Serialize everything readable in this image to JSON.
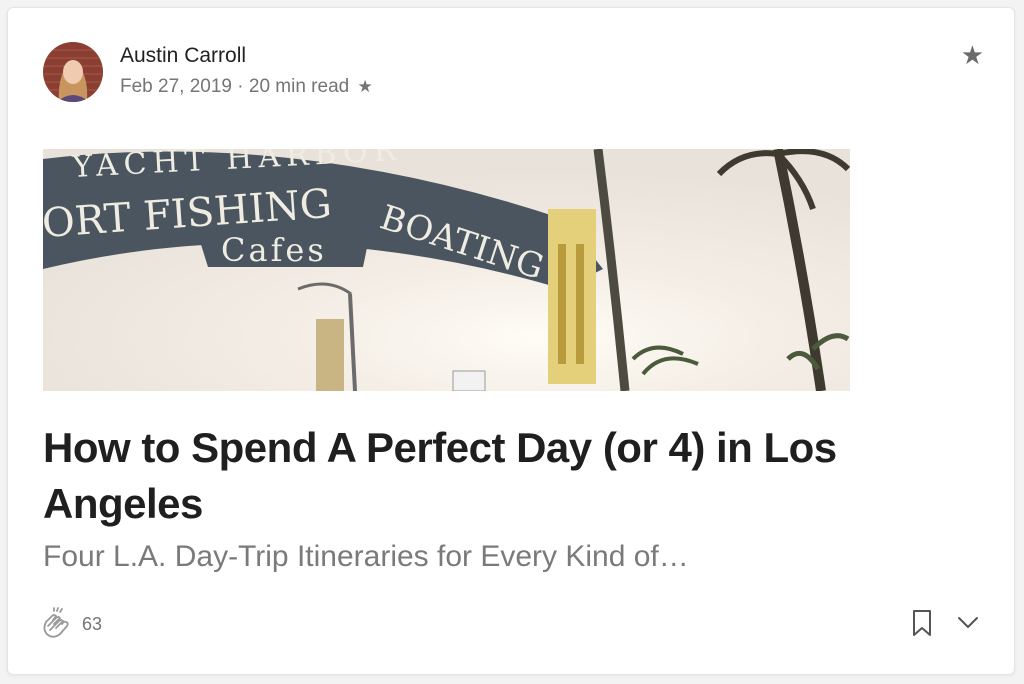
{
  "author": {
    "name": "Austin Carroll",
    "date": "Feb 27, 2019",
    "read_time": "20 min read",
    "separator": "·",
    "member_star": "★"
  },
  "card": {
    "top_star": "★"
  },
  "hero_image": {
    "alt": "Santa Monica pier sign",
    "sign_line1": "YACHT HARBOR",
    "sign_line2_left": "ORT FISHING",
    "sign_line2_right": "BOATING",
    "sign_line3": "Cafes"
  },
  "article": {
    "title": "How to Spend A Perfect Day (or 4) in Los Angeles",
    "subtitle": "Four L.A. Day-Trip Itineraries for Every Kind of…"
  },
  "footer": {
    "clap_count": "63",
    "icons": [
      "clap-icon",
      "bookmark-icon",
      "chevron-down-icon"
    ]
  },
  "colors": {
    "title": "#1f1f1f",
    "muted": "#757575",
    "sign": "#4a5560"
  }
}
